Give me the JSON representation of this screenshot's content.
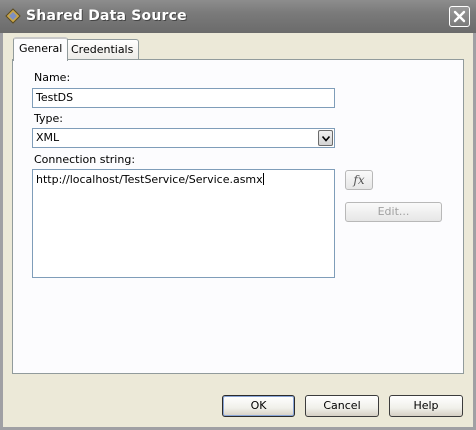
{
  "window": {
    "title": "Shared Data Source",
    "icons": {
      "app": "data-source-icon",
      "close": "close-icon"
    }
  },
  "tabs": [
    {
      "label": "General",
      "active": true
    },
    {
      "label": "Credentials",
      "active": false
    }
  ],
  "form": {
    "name_label": "Name:",
    "name_value": "TestDS",
    "type_label": "Type:",
    "type_value": "XML",
    "conn_label": "Connection string:",
    "conn_value": "http://localhost/TestService/Service.asmx",
    "fx_label": "fx",
    "edit_label": "Edit..."
  },
  "buttons": {
    "ok": "OK",
    "cancel": "Cancel",
    "help": "Help"
  }
}
